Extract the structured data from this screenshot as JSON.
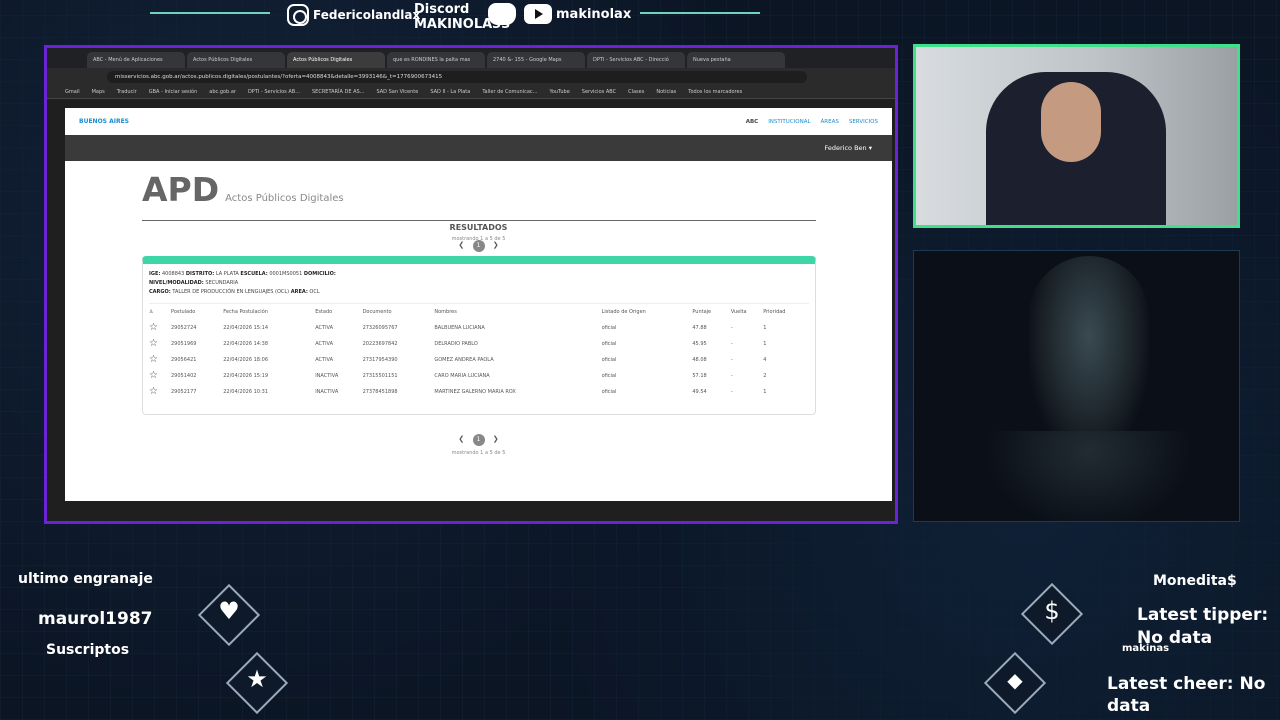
{
  "overlay": {
    "instagram": "Federicolandlax",
    "discord_label": "Discord",
    "discord_name": "MAKINOLA33",
    "youtube": "makinolax",
    "gear_label": "ultimo engranaje",
    "gear_user": "maurol1987",
    "subs_label": "Suscriptos",
    "coins_label": "Monedita$",
    "tipper_label": "Latest tipper:",
    "tipper_value": "No data",
    "makinas_label": "makinas",
    "cheer_label": "Latest cheer: No",
    "cheer_value": "data"
  },
  "browser": {
    "tabs": [
      "ABC - Menú de Aplicaciones",
      "Actos Públicos Digitales",
      "Actos Públicos Digitales",
      "que es RONDINES la palta mas",
      "2740 &- 155 - Google Maps",
      "DPTI - Servicios ABC - Direcció",
      "Nueva pestaña"
    ],
    "url": "misservicios.abc.gob.ar/actos.publicos.digitales/postulantes/?oferta=4008843&detalle=3993146&_t=1776900673415",
    "bookmarks": [
      "Gmail",
      "Maps",
      "Traducir",
      "GBA - Iniciar sesión",
      "abc.gob.ar",
      "DPTI - Servicios AB...",
      "SECRETARÍA DE AS...",
      "SAD San Vicente",
      "SAD II - La Plata",
      "Taller de Comunicac...",
      "YouTube",
      "Servicios ABC",
      "Clases",
      "Noticias",
      "Todos los marcadores"
    ]
  },
  "site": {
    "logo": "BUENOS AIRES",
    "nav": [
      "ABC",
      "INSTITUCIONAL",
      "ÁREAS",
      "SERVICIOS"
    ],
    "user": "Federico Ben",
    "title": "APD",
    "subtitle": "Actos Públicos Digitales",
    "results_title": "RESULTADOS",
    "results_sub": "mostrando 1 a 5 de 5",
    "page": "1",
    "footer": "mostrando 1 a 5 de 5"
  },
  "card": {
    "ige_label": "IGE:",
    "ige": "4008843",
    "distrito_label": "DISTRITO:",
    "distrito": "LA PLATA",
    "escuela_label": "ESCUELA:",
    "escuela": "0001MS0051",
    "domicilio_label": "DOMICILIO:",
    "nivel_label": "NIVEL/MODALIDAD:",
    "nivel": "SECUNDARIA",
    "cargo_label": "CARGO:",
    "cargo": "TALLER DE PRODUCCIÓN EN LENGUAJES (OCL)",
    "area_label": "AREA:",
    "area": "OCL"
  },
  "table": {
    "headers": [
      "Postulado",
      "Fecha Postulación",
      "Estado",
      "Documento",
      "Nombres",
      "Listado de Origen",
      "Puntaje",
      "Vuelta",
      "Prioridad"
    ],
    "rows": [
      [
        "29052724",
        "22/04/2026 15:14",
        "ACTIVA",
        "27326095767",
        "BALBUENA LUCIANA",
        "oficial",
        "47.88",
        "-",
        "1"
      ],
      [
        "29051969",
        "22/04/2026 14:38",
        "ACTIVA",
        "20223697842",
        "DELRADIO PABLO",
        "oficial",
        "45.95",
        "-",
        "1"
      ],
      [
        "29056421",
        "22/04/2026 18:06",
        "ACTIVA",
        "27317954390",
        "GOMEZ ANDREA PAOLA",
        "oficial",
        "48.08",
        "-",
        "4"
      ],
      [
        "29051402",
        "22/04/2026 15:19",
        "INACTIVA",
        "27315501151",
        "CARO MARIA LUCIANA",
        "oficial",
        "57.18",
        "-",
        "2"
      ],
      [
        "29052177",
        "22/04/2026 10:31",
        "INACTIVA",
        "27378451898",
        "MARTINEZ GALERNO MARIA ROX",
        "oficial",
        "49.54",
        "-",
        "1"
      ]
    ]
  }
}
